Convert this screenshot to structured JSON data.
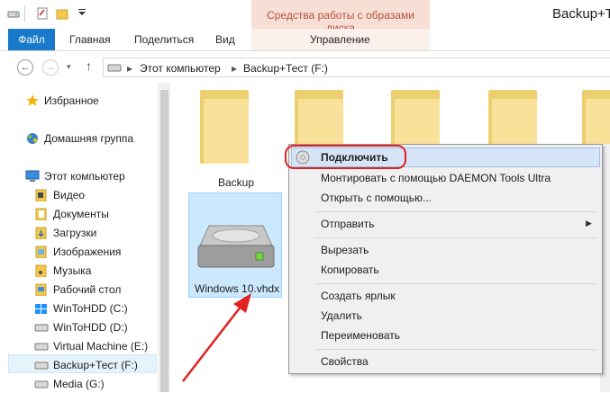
{
  "window": {
    "title": "Backup+T",
    "context_header": "Средства работы с образами диска"
  },
  "ribbon": {
    "tabs": [
      "Файл",
      "Главная",
      "Поделиться",
      "Вид"
    ],
    "context_tab": "Управление"
  },
  "address": {
    "crumbs": [
      "Этот компьютер",
      "Backup+Тест (F:)"
    ]
  },
  "sidebar": {
    "favorites": "Избранное",
    "homegroup": "Домашняя группа",
    "this_pc": "Этот компьютер",
    "items": [
      "Видео",
      "Документы",
      "Загрузки",
      "Изображения",
      "Музыка",
      "Рабочий стол",
      "WinToHDD (C:)",
      "WinToHDD (D:)",
      "Virtual Machine (E:)",
      "Backup+Тест (F:)",
      "Media (G:)"
    ],
    "selected_index": 9
  },
  "content": {
    "folder_label": "Backup",
    "file_label": "Windows 10.vhdx"
  },
  "context_menu": {
    "items": [
      "Подключить",
      "Монтировать с помощью DAEMON Tools Ultra",
      "Открыть с помощью...",
      "Отправить",
      "Вырезать",
      "Копировать",
      "Создать ярлык",
      "Удалить",
      "Переименовать",
      "Свойства"
    ]
  },
  "colors": {
    "accent": "#1979ca",
    "context_tab": "#f8dfd5",
    "highlight": "#e02222"
  }
}
